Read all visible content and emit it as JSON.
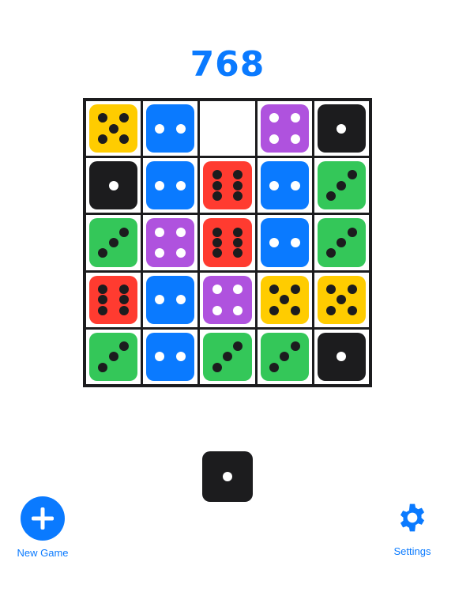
{
  "score": "768",
  "board": [
    [
      5,
      2,
      0,
      4,
      1
    ],
    [
      1,
      2,
      6,
      2,
      3
    ],
    [
      3,
      4,
      6,
      2,
      3
    ],
    [
      6,
      2,
      4,
      5,
      5
    ],
    [
      3,
      2,
      3,
      3,
      1
    ]
  ],
  "next_die": 1,
  "die_styles": {
    "1": {
      "color": "#1C1C1E",
      "pip": "#FFFFFF"
    },
    "2": {
      "color": "#0A7AFF",
      "pip": "#FFFFFF"
    },
    "3": {
      "color": "#34C759",
      "pip": "#1C1C1E"
    },
    "4": {
      "color": "#AF52DE",
      "pip": "#FFFFFF"
    },
    "5": {
      "color": "#FFCC00",
      "pip": "#1C1C1E"
    },
    "6": {
      "color": "#FF3B30",
      "pip": "#1C1C1E"
    }
  },
  "buttons": {
    "new_game": {
      "label": "New Game",
      "icon": "plus-icon"
    },
    "settings": {
      "label": "Settings",
      "icon": "gear-icon"
    }
  },
  "accent": "#0A7AFF"
}
